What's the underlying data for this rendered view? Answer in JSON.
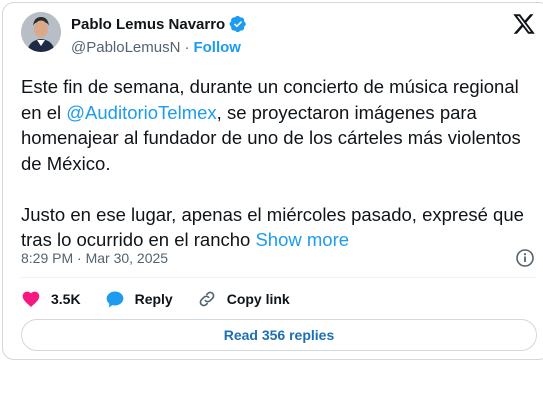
{
  "author": {
    "name": "Pablo Lemus Navarro",
    "handle": "@PabloLemusN",
    "separator": "·",
    "follow_label": "Follow"
  },
  "tweet": {
    "text_part1": "Este fin de semana, durante un concierto de música regional en el ",
    "mention": "@AuditorioTelmex",
    "text_part2": ", se proyectaron imágenes para homenajear al fundador de uno de los cárteles más violentos de México.\n\nJusto en ese lugar, apenas el miércoles pasado, expresé que tras lo ocurrido en el rancho ",
    "show_more": "Show more",
    "timestamp": "8:29 PM · Mar 30, 2025"
  },
  "actions": {
    "like_count": "3.5K",
    "reply_label": "Reply",
    "copy_link_label": "Copy link"
  },
  "replies_button": "Read 356 replies",
  "colors": {
    "accent": "#1d9bf0",
    "like": "#f91880",
    "text": "#0f1419",
    "muted": "#536471"
  },
  "icons": [
    "verified-badge-icon",
    "x-logo-icon",
    "info-icon",
    "heart-icon",
    "reply-bubble-icon",
    "link-icon"
  ]
}
